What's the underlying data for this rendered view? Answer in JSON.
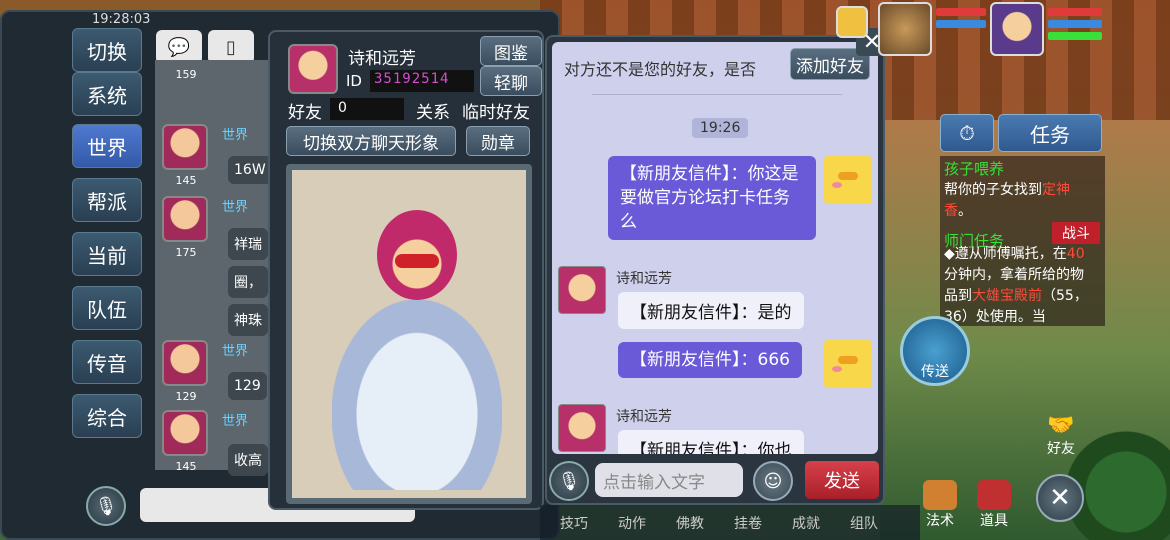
{
  "status_bar": {
    "time": "19:28:03"
  },
  "left_panel": {
    "tabs": [
      "切换",
      "系统",
      "世界",
      "帮派",
      "当前",
      "队伍",
      "传音",
      "综合"
    ],
    "active_tab": "世界",
    "levels": [
      "159",
      "145",
      "175",
      "129",
      "145"
    ],
    "channel_tag": "世界",
    "peek_messages": [
      "16W",
      "祥瑞",
      "圈，",
      "神珠",
      "129",
      "收高"
    ]
  },
  "profile": {
    "name": "诗和远芳",
    "id_label": "ID",
    "id_value": "35192514",
    "atlas_button": "图鉴",
    "chat_button": "轻聊",
    "friendship_label": "好友",
    "friendship_value": "0",
    "relation_label": "关系",
    "relation_value": "临时好友",
    "switch_button": "切换双方聊天形象",
    "medal_button": "勋章"
  },
  "chat": {
    "notice": "对方还不是您的好友，是否",
    "add_friend_button": "添加好友",
    "time": "19:26",
    "messages": [
      {
        "from": "me",
        "text": "【新朋友信件】：你这是要做官方论坛打卡任务么"
      },
      {
        "from": "them",
        "sender": "诗和远芳",
        "text": "【新朋友信件】：是的"
      },
      {
        "from": "me",
        "text": "【新朋友信件】：666"
      },
      {
        "from": "them",
        "sender": "诗和远芳",
        "text": "【新朋友信件】：你也"
      }
    ],
    "input_placeholder": "点击输入文字",
    "send_button": "发送"
  },
  "hud": {
    "task_button": "任务",
    "task1_title": "孩子喂养",
    "task1_text_a": "帮你的子女找到",
    "task1_highlight": "定神香",
    "task1_text_b": "。",
    "task2_title": "师门任务",
    "battle_label": "战斗",
    "task2_text_a": "◆遵从师傅嘱托，在",
    "task2_highlight_minutes": "40",
    "task2_text_b": "分钟内，拿着所给的物品到",
    "task2_highlight_place": "大雄宝殿前",
    "task2_text_c": "（55，36）处使用。当",
    "teleport_label": "传送",
    "friends_label": "好友",
    "magic_label": "法术",
    "items_label": "道具"
  },
  "bottom_bar": {
    "items": [
      "技巧",
      "动作",
      "佛教",
      "挂卷",
      "成就",
      "组队"
    ]
  },
  "colors": {
    "accent_blue": "#3459a8",
    "send_red": "#c0202a",
    "highlight_red": "#ff4a3a",
    "task_green": "#3ae03a"
  }
}
